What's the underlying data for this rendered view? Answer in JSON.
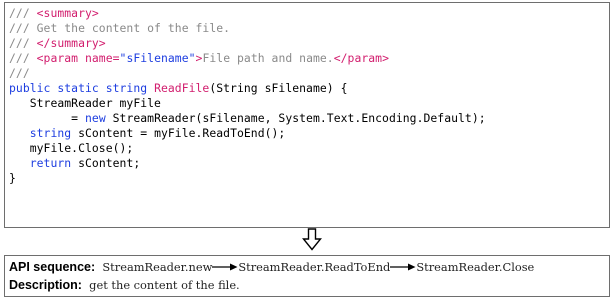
{
  "code": {
    "lines": [
      [
        {
          "t": "/// ",
          "c": "p"
        },
        {
          "t": "<summary>",
          "c": "t"
        }
      ],
      [
        {
          "t": "/// Get the content of the file.",
          "c": "c"
        }
      ],
      [
        {
          "t": "/// ",
          "c": "p"
        },
        {
          "t": "</summary>",
          "c": "t"
        }
      ],
      [
        {
          "t": "/// ",
          "c": "p"
        },
        {
          "t": "<param name=",
          "c": "t"
        },
        {
          "t": "\"sFilename\"",
          "c": "k"
        },
        {
          "t": ">",
          "c": "t"
        },
        {
          "t": "File path and name.",
          "c": "c"
        },
        {
          "t": "</param>",
          "c": "t"
        }
      ],
      [
        {
          "t": "///",
          "c": "p"
        }
      ],
      [
        {
          "t": "public static string ",
          "c": "k"
        },
        {
          "t": "ReadFile",
          "c": "t"
        },
        {
          "t": "(String sFilename) {",
          "c": ""
        }
      ],
      [
        {
          "t": "   StreamReader myFile",
          "c": ""
        }
      ],
      [
        {
          "t": "         = ",
          "c": ""
        },
        {
          "t": "new ",
          "c": "k"
        },
        {
          "t": "StreamReader(sFilename, System.Text.Encoding.Default);",
          "c": ""
        }
      ],
      [
        {
          "t": "   ",
          "c": ""
        },
        {
          "t": "string ",
          "c": "k"
        },
        {
          "t": "sContent = myFile.ReadToEnd();",
          "c": ""
        }
      ],
      [
        {
          "t": "   myFile.Close();",
          "c": ""
        }
      ],
      [
        {
          "t": "   ",
          "c": ""
        },
        {
          "t": "return ",
          "c": "k"
        },
        {
          "t": "sContent;",
          "c": ""
        }
      ],
      [
        {
          "t": "}",
          "c": ""
        }
      ]
    ]
  },
  "api": {
    "sequence_label": "API sequence:",
    "sequence": [
      "StreamReader.new",
      "StreamReader.ReadToEnd",
      "StreamReader.Close"
    ],
    "description_label": "Description:",
    "description": "get the content of the file."
  },
  "colors": {
    "comment": "#8a8a8a",
    "keyword": "#1e3ee0",
    "tag": "#c8203a",
    "method": "#d21e6e",
    "border": "#6e6e6e"
  },
  "icons": {
    "down_arrow": "hollow-down-arrow-icon",
    "sequence_arrow": "right-arrow-icon"
  }
}
